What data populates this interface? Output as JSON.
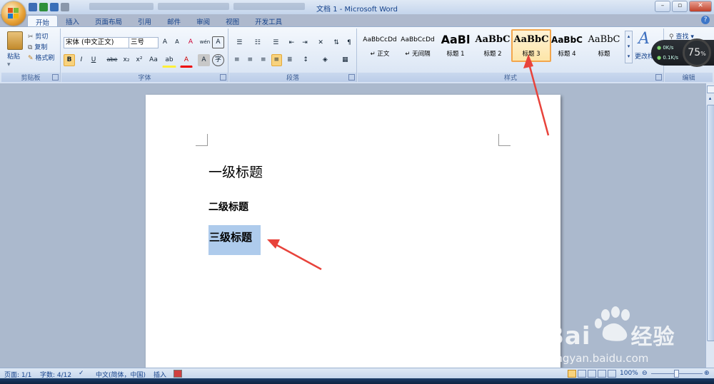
{
  "window": {
    "title": "文档 1 - Microsoft Word",
    "controls": [
      "–",
      "▫",
      "✕"
    ]
  },
  "tabs": [
    "开始",
    "插入",
    "页面布局",
    "引用",
    "邮件",
    "审阅",
    "视图",
    "开发工具"
  ],
  "clipboard": {
    "paste_label": "粘贴",
    "cut_label": "剪切",
    "copy_label": "复制",
    "format_painter_label": "格式刷",
    "group_label": "剪贴板"
  },
  "font": {
    "font_name": "宋体 (中文正文)",
    "font_size": "三号",
    "grow_label": "A",
    "shrink_label": "A",
    "clear_label": "A",
    "phonetic_label": "wén",
    "border_label": "A",
    "bold": "B",
    "italic": "I",
    "underline": "U",
    "strike": "abe",
    "subscript": "x₂",
    "superscript": "x²",
    "case": "Aa",
    "highlight_label": "ab",
    "font_color_label": "A",
    "shading_label": "A",
    "enclose_label": "字",
    "group_label": "字体"
  },
  "paragraph": {
    "group_label": "段落"
  },
  "styles": {
    "group_label": "样式",
    "change_styles_label": "更改样",
    "items": [
      {
        "sample": "AaBbCcDd",
        "name": "↵ 正文"
      },
      {
        "sample": "AaBbCcDd",
        "name": "↵ 无间隔"
      },
      {
        "sample": "AaBl",
        "name": "标题 1"
      },
      {
        "sample": "AaBbC",
        "name": "标题 2"
      },
      {
        "sample": "AaBbC",
        "name": "标题 3"
      },
      {
        "sample": "AaBbC",
        "name": "标题 4"
      },
      {
        "sample": "AaBbC",
        "name": "标题"
      }
    ],
    "selected_index": 4
  },
  "editing": {
    "find_label": "查找",
    "group_label": "编辑"
  },
  "gadget": {
    "up": "0K/s",
    "down": "0.1K/s",
    "percent": "75"
  },
  "document": {
    "heading1": "一级标题",
    "heading2": "二级标题",
    "heading3": "三级标题"
  },
  "statusbar": {
    "page": "页面: 1/1",
    "words": "字数: 4/12",
    "language": "中文(简体，中国)",
    "insert_mode": "插入",
    "zoom": "100%"
  },
  "watermark": {
    "brand": "Bai",
    "brand_cn": "经验",
    "url": "jingyan.baidu.com"
  },
  "colors": {
    "ribbon_bg": "#dbe6f4",
    "selection": "#aecbec",
    "arrow": "#e8433b",
    "style_selected_border": "#f3a64c"
  }
}
